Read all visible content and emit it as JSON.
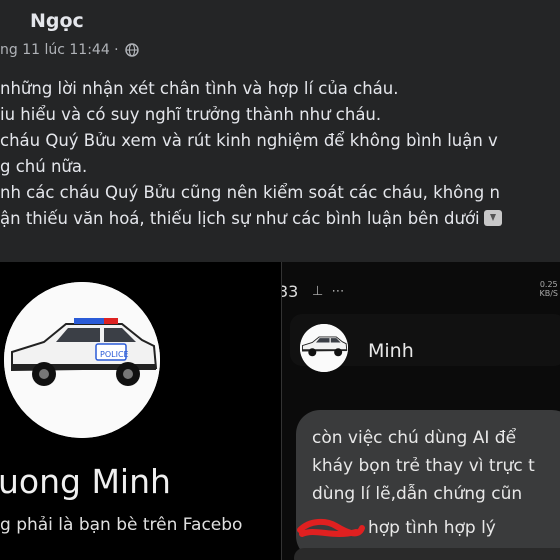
{
  "post": {
    "author": "Ngọc",
    "timestamp": "ng 11 lúc 11:44 ·",
    "privacy_icon": "globe-icon",
    "lines": [
      "những lời nhận xét chân tình và hợp lí của cháu.",
      "iu hiểu và có suy nghĩ trưởng thành như cháu.",
      "cháu Quý Bửu xem và rút kinh nghiệm để không bình luận v",
      "g chú nữa.",
      "nh các cháu Quý Bửu cũng nên kiểm soát các cháu, không n",
      "ận thiếu văn hoá, thiếu lịch sự như các bình luận bên dưới"
    ],
    "end_emoji": "down-arrow-emoji"
  },
  "left_screenshot": {
    "avatar": "police-car-avatar",
    "car_label": "POLICE",
    "profile_name": "uong Minh",
    "friend_note": "g phải là bạn bè trên Facebo"
  },
  "right_screenshot": {
    "status_time": "33",
    "status_icons": "⊥ ⋯",
    "net_speed_value": "0.25",
    "net_speed_unit": "KB/S",
    "chat_avatar": "police-car-avatar",
    "chat_name": "Minh",
    "message_lines": [
      "còn việc chú dùng AI để",
      "kháy bọn trẻ thay vì trực t",
      "dùng lí lẽ,dẫn chứng cũn",
      "hợp tình hợp lý"
    ]
  }
}
